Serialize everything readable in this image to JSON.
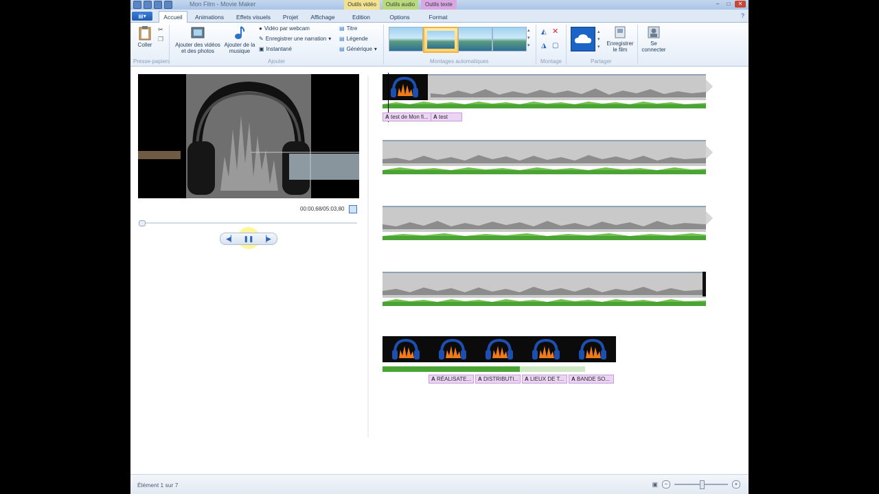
{
  "window": {
    "title": "Mon Film - Movie Maker",
    "context_tabs": [
      "Outils vidéo",
      "Outils audio",
      "Outils texte"
    ]
  },
  "tabs": [
    "Accueil",
    "Animations",
    "Effets visuels",
    "Projet",
    "Affichage",
    "Edition",
    "Options",
    "Format"
  ],
  "ribbon": {
    "clipboard": {
      "paste": "Coller",
      "group": "Presse-papiers"
    },
    "add": {
      "add_media": "Ajouter des vidéos et des photos",
      "add_music": "Ajouter de la musique",
      "webcam": "Vidéo par webcam",
      "narration": "Enregistrer une narration",
      "snapshot": "Instantané",
      "title": "Titre",
      "caption": "Légende",
      "credits": "Générique",
      "group": "Ajouter"
    },
    "automovie_group": "Montages automatiques",
    "edit_group": "Montage",
    "share": {
      "save_movie": "Enregistrer le film",
      "sign_in": "Se connecter",
      "group": "Partager"
    }
  },
  "preview": {
    "timecode": "00:00,68/05:03,80",
    "seek_position": 0
  },
  "storyboard": {
    "track1_captions": [
      "test de Mon fi...",
      "test"
    ],
    "track5_captions": [
      "RÉALISATE...",
      "DISTRIBUTI...",
      "LIEUX DE T...",
      "BANDE SO..."
    ]
  },
  "status": {
    "text": "Élément 1 sur 7",
    "zoom_level": 0.5
  },
  "colors": {
    "accent": "#2b63b8",
    "audio_wave": "#4aa332",
    "caption_bg": "#ecd4f4"
  }
}
